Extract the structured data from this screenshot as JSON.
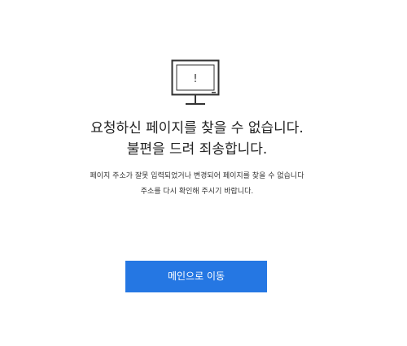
{
  "error": {
    "icon": "monitor-alert-icon",
    "icon_glyph": "!",
    "title_line1": "요청하신 페이지를 찾을 수 없습니다.",
    "title_line2": "불편을 드려 죄송합니다.",
    "description_line1": "페이지 주소가 잘못 입력되었거나 변경되어 페이지를 찾을 수 없습니다",
    "description_line2": "주소를 다시 확인해 주시기 바랍니다."
  },
  "actions": {
    "main_button_label": "메인으로 이동"
  },
  "colors": {
    "accent": "#2577e3",
    "text": "#222222",
    "icon_stroke": "#333333"
  }
}
